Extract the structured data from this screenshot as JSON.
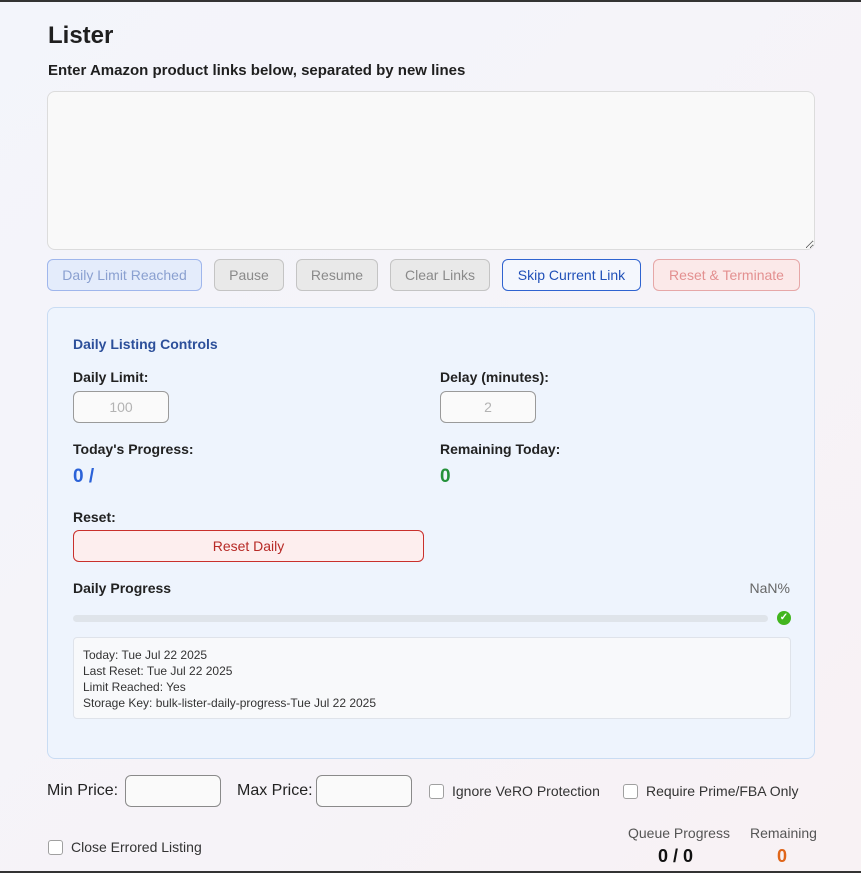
{
  "app": {
    "title": "Lister",
    "subtitle": "Enter Amazon product links below, separated by new lines"
  },
  "links_input": {
    "value": "",
    "placeholder": ""
  },
  "toolbar": {
    "daily_limit_label": "Daily Limit Reached",
    "pause_label": "Pause",
    "resume_label": "Resume",
    "clear_label": "Clear Links",
    "skip_label": "Skip Current Link",
    "reset_terminate_label": "Reset & Terminate"
  },
  "daily_controls": {
    "title": "Daily Listing Controls",
    "daily_limit_label": "Daily Limit:",
    "daily_limit_value": "100",
    "delay_label": "Delay (minutes):",
    "delay_value": "2",
    "todays_progress_label": "Today's Progress:",
    "todays_progress_value": "0 /",
    "remaining_label": "Remaining Today:",
    "remaining_value": "0",
    "reset_label": "Reset:",
    "reset_button_label": "Reset Daily",
    "daily_progress_label": "Daily Progress",
    "daily_progress_pct": "NaN%",
    "daily_progress_fraction": 0,
    "debug": {
      "today": "Today: Tue Jul 22 2025",
      "last_reset": "Last Reset: Tue Jul 22 2025",
      "limit_reached": "Limit Reached: Yes",
      "storage_key": "Storage Key: bulk-lister-daily-progress-Tue Jul 22 2025"
    }
  },
  "filters": {
    "min_price_label": "Min Price:",
    "min_price_value": "",
    "max_price_label": "Max Price:",
    "max_price_value": "",
    "ignore_vero_label": "Ignore VeRO Protection",
    "ignore_vero_checked": false,
    "require_prime_label": "Require Prime/FBA Only",
    "require_prime_checked": false,
    "close_errored_label": "Close Errored Listing",
    "close_errored_checked": false
  },
  "queue": {
    "progress_label": "Queue Progress",
    "progress_value": "0 / 0",
    "remaining_label": "Remaining",
    "remaining_value": "0"
  },
  "colors": {
    "accent_blue": "#2b62d8",
    "success_green": "#24913a",
    "danger_red": "#b72a26",
    "remaining_orange": "#e0661a"
  }
}
